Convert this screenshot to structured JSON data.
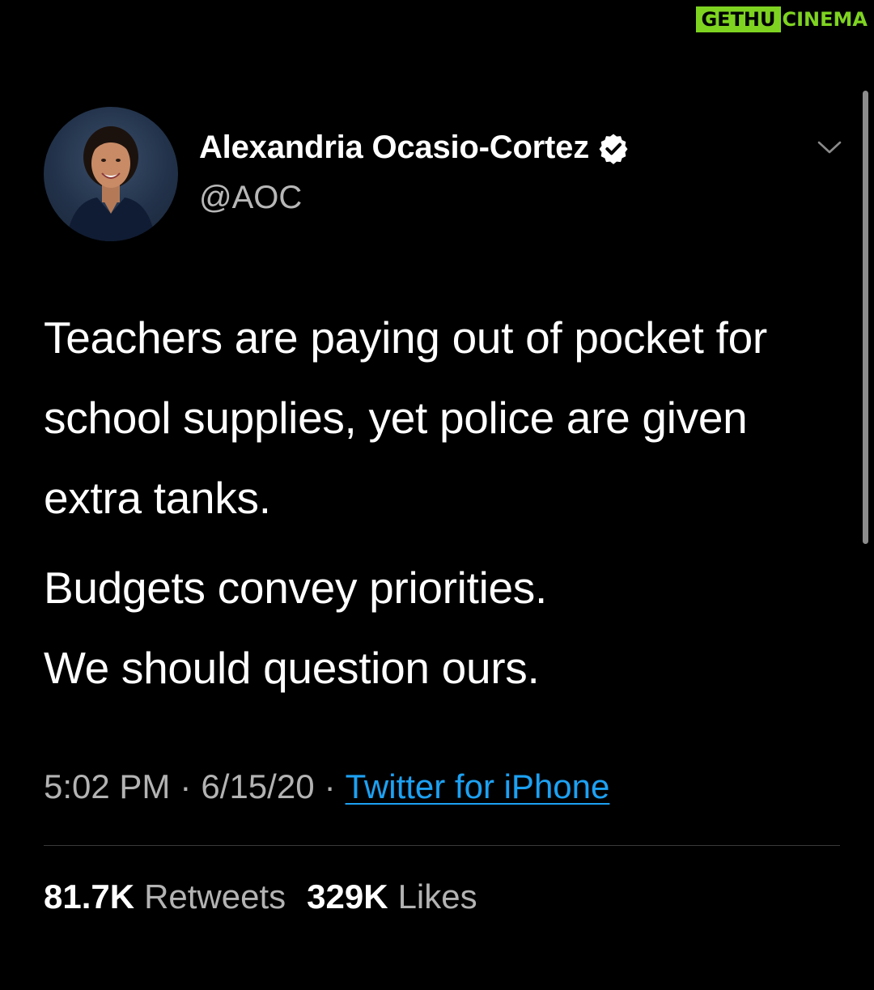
{
  "watermark": {
    "boxed_text": "GETHU",
    "plain_text": "CINEMA",
    "color": "#7ed321"
  },
  "tweet": {
    "author": {
      "display_name": "Alexandria Ocasio-Cortez",
      "handle": "@AOC",
      "verified": true,
      "avatar_icon": "profile-photo"
    },
    "menu_icon": "chevron-down-icon",
    "paragraphs": [
      "Teachers are paying out of pocket for school supplies, yet police are given extra tanks.",
      "Budgets convey priorities.\nWe should question ours."
    ],
    "time": "5:02 PM",
    "date": "6/15/20",
    "source": "Twitter for iPhone",
    "separator": "·",
    "stats": {
      "retweets_count": "81.7K",
      "retweets_label": "Retweets",
      "likes_count": "329K",
      "likes_label": "Likes"
    }
  },
  "colors": {
    "background": "#000000",
    "link": "#1da1f2",
    "secondary_text": "#b3b3b3"
  }
}
